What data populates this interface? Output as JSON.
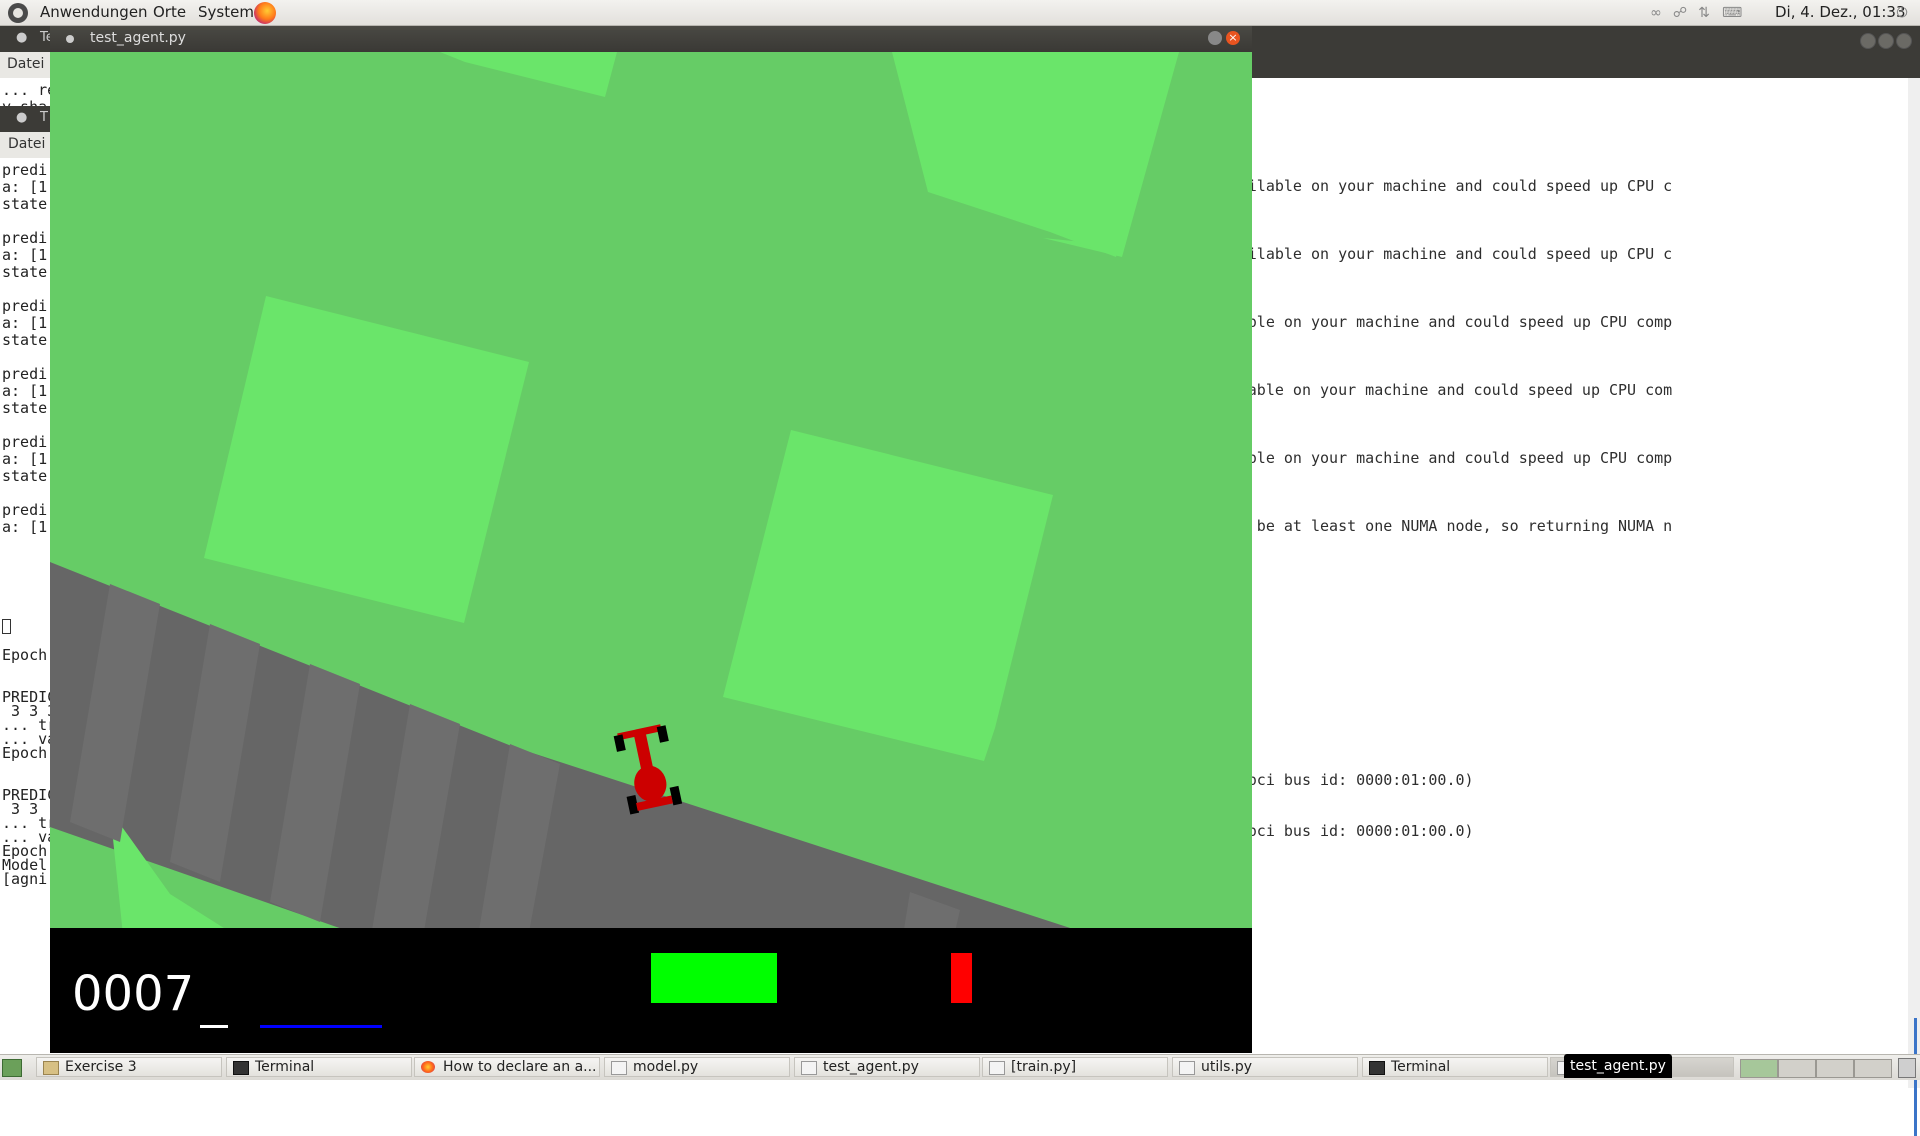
{
  "top_panel": {
    "menus": [
      "Anwendungen",
      "Orte",
      "System"
    ],
    "clock": "Di,  4. Dez., 01:33",
    "tray_icons": [
      "bluetooth-icon",
      "lock-icon",
      "network-icon",
      "keyboard-icon",
      "power-icon"
    ]
  },
  "background_terminal_right": {
    "lines": [
      "ctions, but these are available on your machine and could speed up CPU c",
      "ctions, but these are available on your machine and could speed up CPU c",
      "ons, but these are available on your machine and could speed up CPU comp",
      "ions, but these are available on your machine and could speed up CPU com",
      "ons, but these are available on your machine and could speed up CPU comp",
      "alue (-1), but there must be at least one NUMA node, so returning NUMA n"
    ],
    "gpu_lines": [
      "e: GeForce GTX 1060 3GB, pci bus id: 0000:01:00.0)",
      "e: GeForce GTX 1060 3GB, pci bus id: 0000:01:00.0)"
    ]
  },
  "background_terminal_left": {
    "title_fragment": "Te",
    "menu": "Datei",
    "top_lines": [
      "... re",
      "y_sha"
    ],
    "inner_title_fragment": "T",
    "inner_menu": "Datei",
    "inner_lines": [
      "predi",
      "a: [1",
      "state",
      "",
      "predi",
      "a: [1",
      "state",
      "",
      "predi",
      "a: [1",
      "state",
      "",
      "predi",
      "a: [1",
      "state",
      "",
      "predi",
      "a: [1",
      "state",
      "",
      "predi",
      "a: [1"
    ],
    "outer_lines": [
      "Epoch:",
      "",
      "",
      "PREDIC",
      " 3 3 3",
      "... tr",
      "... va",
      "Epoch:",
      "",
      "",
      "PREDIC",
      " 3 3 ",
      "... tr",
      "... va",
      "Epoch:",
      "Model ",
      "[agni"
    ]
  },
  "game_window": {
    "title": "test_agent.py",
    "score": "0007",
    "colors": {
      "grass": "#66cc66",
      "grass_tile": "#6ae56a",
      "road": "#666666",
      "car": "#cc0000",
      "hud": "#000000"
    },
    "hud_indicators": {
      "speed_bar_color": "#ffffff",
      "abs_bar_color": "#0000ff",
      "steering_bar_color": "#00ff00",
      "gyro_bar_color": "#ff0000"
    }
  },
  "taskbar": {
    "items": [
      {
        "label": "Exercise 3",
        "icon": "folder-icon"
      },
      {
        "label": "Terminal",
        "icon": "terminal-icon"
      },
      {
        "label": "How to declare an a...",
        "icon": "firefox-icon"
      },
      {
        "label": "model.py",
        "icon": "python-file-icon"
      },
      {
        "label": "test_agent.py",
        "icon": "python-file-icon"
      },
      {
        "label": "[train.py]",
        "icon": "python-file-icon"
      },
      {
        "label": "utils.py",
        "icon": "python-file-icon"
      },
      {
        "label": "Terminal",
        "icon": "terminal-icon"
      },
      {
        "label": "y",
        "icon": "python-file-icon"
      }
    ],
    "tooltip": "test_agent.py"
  }
}
